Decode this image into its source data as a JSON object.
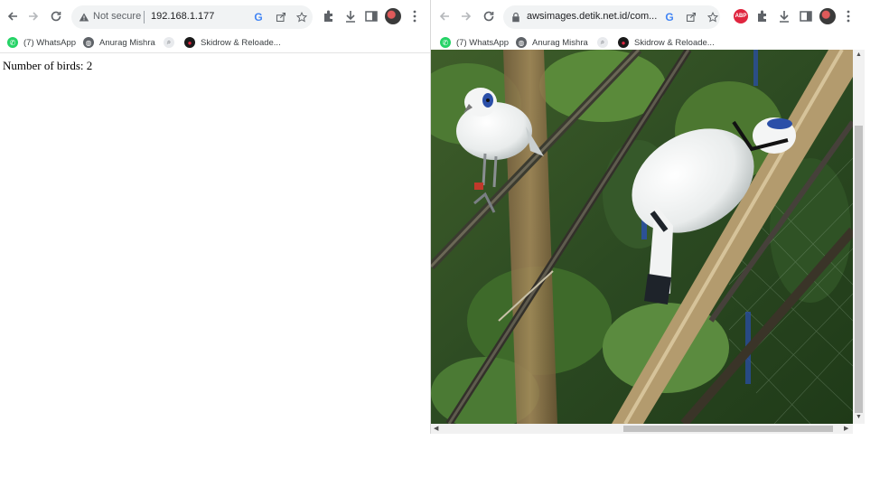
{
  "left_window": {
    "address": {
      "security_label": "Not secure",
      "url": "192.168.1.177"
    },
    "bookmarks": [
      {
        "label": "(7) WhatsApp",
        "icon": "whatsapp-icon"
      },
      {
        "label": "Anurag Mishra",
        "icon": "globe-icon"
      },
      {
        "label": "",
        "icon": "search-icon"
      },
      {
        "label": "Skidrow & Reloade...",
        "icon": "skidrow-icon"
      }
    ],
    "content": {
      "birds_text": "Number of birds: 2"
    }
  },
  "right_window": {
    "address": {
      "url": "awsimages.detik.net.id/com..."
    },
    "bookmarks": [
      {
        "label": "(7) WhatsApp",
        "icon": "whatsapp-icon"
      },
      {
        "label": "Anurag Mishra",
        "icon": "globe-icon"
      },
      {
        "label": "",
        "icon": "search-icon"
      },
      {
        "label": "Skidrow & Reloade...",
        "icon": "skidrow-icon"
      }
    ],
    "extension_badge": "ABP",
    "image_description_icon": "bali-myna-birds-photo"
  },
  "colors": {
    "whatsapp": "#25d366",
    "abp": "#e0253f",
    "toolbar_icon": "#5f6368"
  }
}
